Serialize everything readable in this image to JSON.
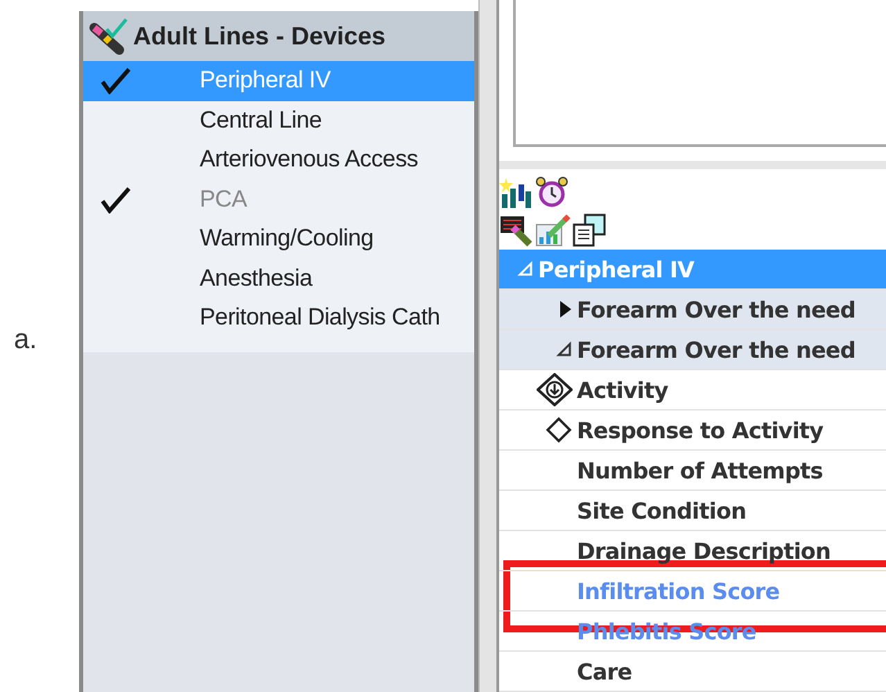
{
  "label": "a.",
  "devices": {
    "title": "Adult Lines - Devices",
    "items": [
      {
        "label": "Peripheral IV",
        "checked": true,
        "selected": true,
        "disabled": false
      },
      {
        "label": "Central Line",
        "checked": false,
        "selected": false,
        "disabled": false
      },
      {
        "label": "Arteriovenous Access",
        "checked": false,
        "selected": false,
        "disabled": false
      },
      {
        "label": "PCA",
        "checked": true,
        "selected": false,
        "disabled": true
      },
      {
        "label": "Warming/Cooling",
        "checked": false,
        "selected": false,
        "disabled": false
      },
      {
        "label": "Anesthesia",
        "checked": false,
        "selected": false,
        "disabled": false
      },
      {
        "label": "Peritoneal Dialysis Cath",
        "checked": false,
        "selected": false,
        "disabled": false
      }
    ]
  },
  "tree": [
    {
      "label": "Peripheral IV",
      "selected": true,
      "expanded": true,
      "children": [
        {
          "label": "Forearm Over the need",
          "selected": false,
          "expanded": false
        },
        {
          "label": "Forearm Over the need",
          "selected": false,
          "expanded": true,
          "children": [
            {
              "label": "Activity",
              "kind": "required",
              "linked": false
            },
            {
              "label": "Response to Activity",
              "kind": "optional",
              "linked": false
            },
            {
              "label": "Number of Attempts",
              "kind": "plain",
              "linked": false
            },
            {
              "label": "Site Condition",
              "kind": "plain",
              "linked": false
            },
            {
              "label": "Drainage Description",
              "kind": "plain",
              "linked": false
            },
            {
              "label": "Infiltration Score",
              "kind": "plain",
              "linked": true
            },
            {
              "label": "Phlebitis Score",
              "kind": "plain",
              "linked": true
            },
            {
              "label": "Care",
              "kind": "plain",
              "linked": false
            }
          ]
        }
      ]
    }
  ]
}
